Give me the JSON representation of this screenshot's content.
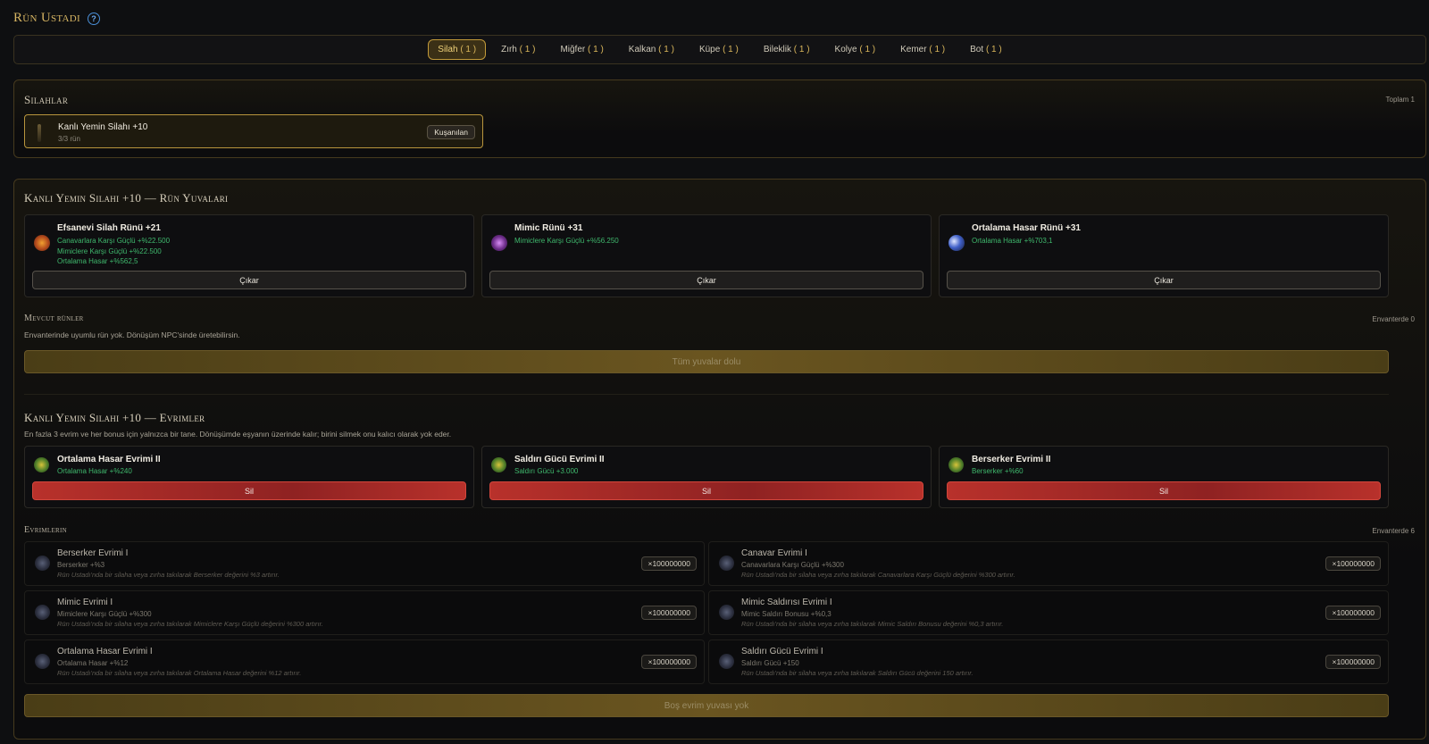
{
  "page": {
    "title": "Rün Ustadı",
    "help_icon": "?"
  },
  "tabs": [
    {
      "label": "Silah",
      "count": "( 1 )",
      "active": true
    },
    {
      "label": "Zırh",
      "count": "( 1 )"
    },
    {
      "label": "Miğfer",
      "count": "( 1 )"
    },
    {
      "label": "Kalkan",
      "count": "( 1 )"
    },
    {
      "label": "Küpe",
      "count": "( 1 )"
    },
    {
      "label": "Bileklik",
      "count": "( 1 )"
    },
    {
      "label": "Kolye",
      "count": "( 1 )"
    },
    {
      "label": "Kemer",
      "count": "( 1 )"
    },
    {
      "label": "Bot",
      "count": "( 1 )"
    }
  ],
  "weapons": {
    "title": "Silahlar",
    "total": "Toplam 1",
    "item": {
      "name": "Kanlı Yemin Silahı +10",
      "runes": "3/3 rün",
      "badge": "Kuşanılan"
    }
  },
  "rune_slots": {
    "title": "Kanlı Yemin Silahı +10 — Rün Yuvaları",
    "cards": [
      {
        "name": "Efsanevi Silah Rünü +21",
        "icon": "fire-rune-icon",
        "stats": [
          "Canavarlara Karşı Güçlü +%22.500",
          "Mimiclere Karşı Güçlü +%22.500",
          "Ortalama Hasar +%562,5"
        ],
        "button": "Çıkar"
      },
      {
        "name": "Mimic Rünü +31",
        "icon": "mimic-rune-icon",
        "stats": [
          "Mimiclere Karşı Güçlü +%56.250"
        ],
        "button": "Çıkar"
      },
      {
        "name": "Ortalama Hasar Rünü +31",
        "icon": "moon-rune-icon",
        "stats": [
          "Ortalama Hasar +%703,1"
        ],
        "button": "Çıkar"
      }
    ],
    "available_title": "Mevcut rünler",
    "available_count": "Envanterde 0",
    "available_note": "Envanterinde uyumlu rün yok. Dönüşüm NPC'sinde üretebilirsin.",
    "full_button": "Tüm yuvalar dolu"
  },
  "evolutions": {
    "title": "Kanlı Yemin Silahı +10 — Evrimler",
    "note": "En fazla 3 evrim ve her bonus için yalnızca bir tane. Dönüşümde eşyanın üzerinde kalır; birini silmek onu kalıcı olarak yok eder.",
    "cards": [
      {
        "name": "Ortalama Hasar Evrimi II",
        "stat": "Ortalama Hasar +%240",
        "button": "Sil"
      },
      {
        "name": "Saldırı Gücü Evrimi II",
        "stat": "Saldırı Gücü +3.000",
        "button": "Sil"
      },
      {
        "name": "Berserker Evrimi II",
        "stat": "Berserker +%60",
        "button": "Sil"
      }
    ],
    "inventory_title": "Evrimlerin",
    "inventory_count": "Envanterde 6",
    "inventory": [
      {
        "name": "Berserker Evrimi I",
        "stat": "Berserker +%3",
        "desc": "Rün Ustadı'nda bir silaha veya zırha takılarak Berserker değerini %3 artırır.",
        "qty": "×100000000"
      },
      {
        "name": "Canavar Evrimi I",
        "stat": "Canavarlara Karşı Güçlü +%300",
        "desc": "Rün Ustadı'nda bir silaha veya zırha takılarak Canavarlara Karşı Güçlü değerini %300 artırır.",
        "qty": "×100000000"
      },
      {
        "name": "Mimic Evrimi I",
        "stat": "Mimiclere Karşı Güçlü +%300",
        "desc": "Rün Ustadı'nda bir silaha veya zırha takılarak Mimiclere Karşı Güçlü değerini %300 artırır.",
        "qty": "×100000000"
      },
      {
        "name": "Mimic Saldırısı Evrimi I",
        "stat": "Mimic Saldırı Bonusu +%0,3",
        "desc": "Rün Ustadı'nda bir silaha veya zırha takılarak Mimic Saldırı Bonusu değerini %0,3 artırır.",
        "qty": "×100000000"
      },
      {
        "name": "Ortalama Hasar Evrimi I",
        "stat": "Ortalama Hasar +%12",
        "desc": "Rün Ustadı'nda bir silaha veya zırha takılarak Ortalama Hasar değerini %12 artırır.",
        "qty": "×100000000"
      },
      {
        "name": "Saldırı Gücü Evrimi I",
        "stat": "Saldırı Gücü +150",
        "desc": "Rün Ustadı'nda bir silaha veya zırha takılarak Saldırı Gücü değerini 150 artırır.",
        "qty": "×100000000"
      }
    ],
    "empty_button": "Boş evrim yuvası yok"
  }
}
